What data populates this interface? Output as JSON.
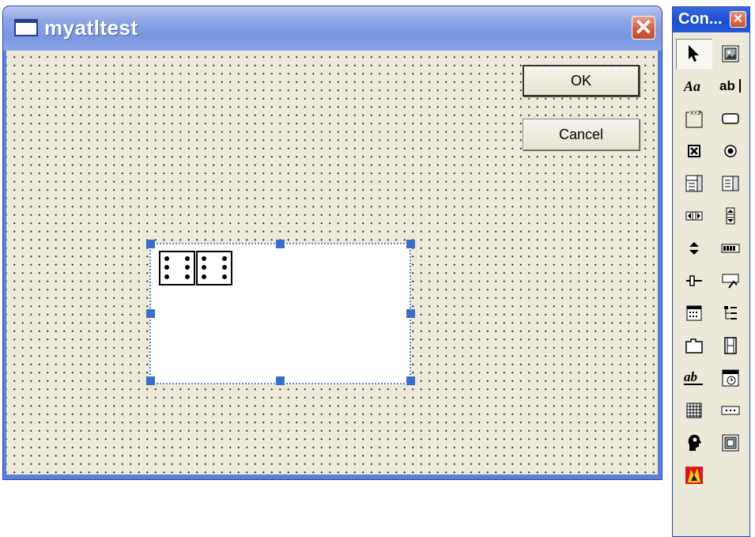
{
  "window": {
    "title": "myatltest"
  },
  "buttons": {
    "ok": "OK",
    "cancel": "Cancel"
  },
  "toolbox": {
    "title": "Con...",
    "tools": [
      "pointer-icon",
      "picture-icon",
      "static-text-icon",
      "edit-box-icon",
      "group-box-icon",
      "button-icon",
      "check-box-icon",
      "radio-button-icon",
      "combo-box-icon",
      "list-box-icon",
      "horizontal-scrollbar-icon",
      "vertical-scrollbar-icon",
      "spin-icon",
      "progress-icon",
      "slider-icon",
      "hot-key-icon",
      "list-control-icon",
      "tree-control-icon",
      "tab-control-icon",
      "animation-icon",
      "rich-edit-icon",
      "date-time-picker-icon",
      "month-calendar-icon",
      "ip-address-icon",
      "custom-control-icon",
      "extended-combo-icon",
      "activex-control-icon"
    ]
  }
}
